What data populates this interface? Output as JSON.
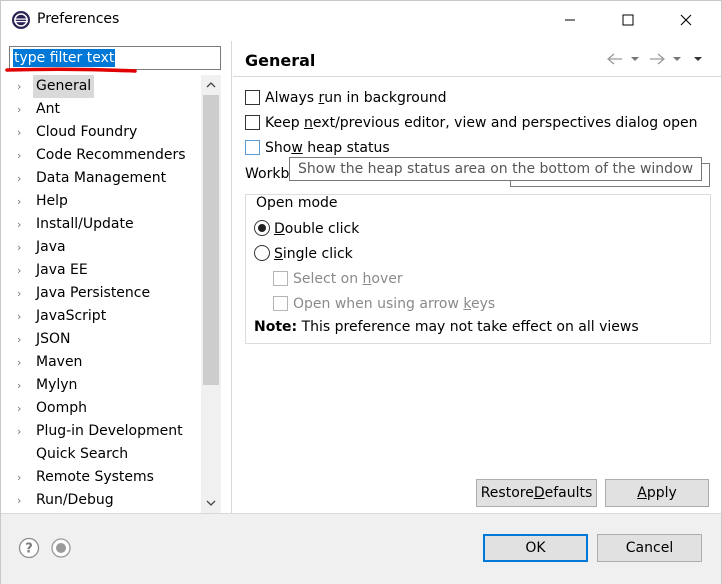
{
  "window": {
    "title": "Preferences"
  },
  "filter": {
    "text": "type filter text"
  },
  "tree": {
    "items": [
      {
        "label": "General",
        "has_children": true
      },
      {
        "label": "Ant",
        "has_children": true
      },
      {
        "label": "Cloud Foundry",
        "has_children": true
      },
      {
        "label": "Code Recommenders",
        "has_children": true
      },
      {
        "label": "Data Management",
        "has_children": true
      },
      {
        "label": "Help",
        "has_children": true
      },
      {
        "label": "Install/Update",
        "has_children": true
      },
      {
        "label": "Java",
        "has_children": true
      },
      {
        "label": "Java EE",
        "has_children": true
      },
      {
        "label": "Java Persistence",
        "has_children": true
      },
      {
        "label": "JavaScript",
        "has_children": true
      },
      {
        "label": "JSON",
        "has_children": true
      },
      {
        "label": "Maven",
        "has_children": true
      },
      {
        "label": "Mylyn",
        "has_children": true
      },
      {
        "label": "Oomph",
        "has_children": true
      },
      {
        "label": "Plug-in Development",
        "has_children": true
      },
      {
        "label": "Quick Search",
        "has_children": false
      },
      {
        "label": "Remote Systems",
        "has_children": true
      },
      {
        "label": "Run/Debug",
        "has_children": true
      }
    ],
    "selected": "General"
  },
  "page": {
    "title": "General",
    "always_run": {
      "pre": "Always ",
      "u": "r",
      "post": "un in background",
      "checked": false
    },
    "keep_next": {
      "pre": "Keep ",
      "u": "n",
      "post": "ext/previous editor, view and perspectives dialog open",
      "checked": false
    },
    "show_heap": {
      "pre": "Sho",
      "u": "w",
      "post": " heap status",
      "checked": false
    },
    "tooltip": "Show the heap status area on the bottom of the window",
    "workbench_label": "Workb",
    "open_mode": {
      "title": "Open mode",
      "double": {
        "pre": "",
        "u": "D",
        "post": "ouble click",
        "selected": true
      },
      "single": {
        "pre": "",
        "u": "S",
        "post": "ingle click",
        "selected": false
      },
      "select_hover": {
        "pre": "Select on ",
        "u": "h",
        "post": "over"
      },
      "open_arrow": {
        "pre": "Open when using arrow ",
        "u": "k",
        "post": "eys"
      }
    },
    "note_bold": "Note:",
    "note_text": " This preference may not take effect on all views",
    "restore_pre": "Restore ",
    "restore_u": "D",
    "restore_post": "efaults",
    "apply_pre": "",
    "apply_u": "A",
    "apply_post": "pply"
  },
  "footer": {
    "ok": "OK",
    "cancel": "Cancel"
  },
  "colors": {
    "selection": "#0078d7",
    "underline_annotation": "#e00000"
  }
}
